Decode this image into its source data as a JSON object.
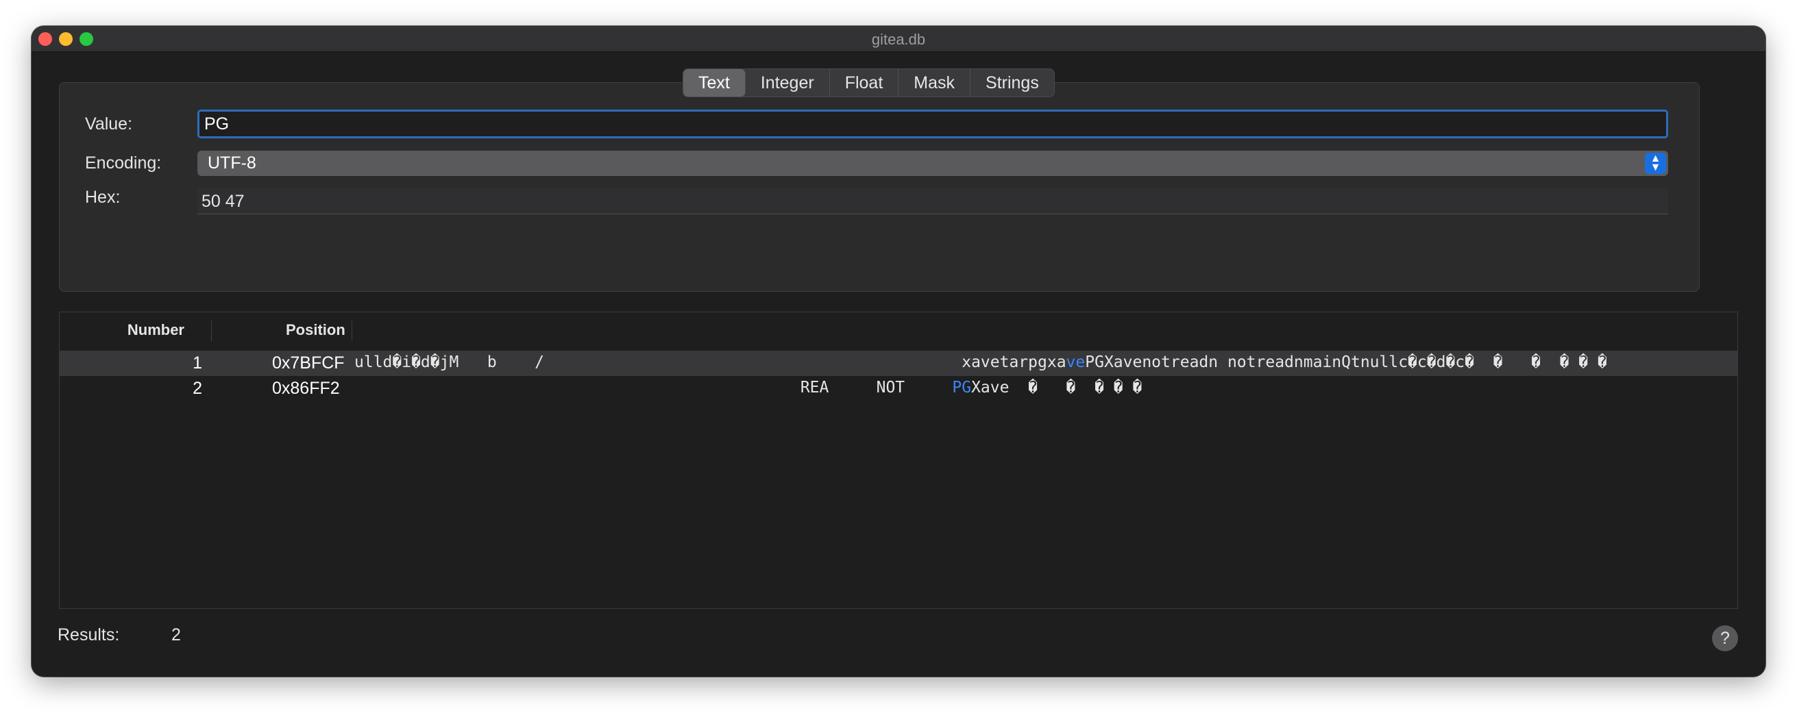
{
  "window": {
    "title": "gitea.db"
  },
  "tabs": [
    {
      "label": "Text",
      "active": true
    },
    {
      "label": "Integer",
      "active": false
    },
    {
      "label": "Float",
      "active": false
    },
    {
      "label": "Mask",
      "active": false
    },
    {
      "label": "Strings",
      "active": false
    }
  ],
  "form": {
    "value_label": "Value:",
    "value": "PG",
    "encoding_label": "Encoding:",
    "encoding": "UTF-8",
    "hex_label": "Hex:",
    "hex": "50 47"
  },
  "table": {
    "columns": [
      "Number",
      "Position"
    ],
    "rows": [
      {
        "number": "1",
        "position": "0x7BFCF",
        "snippet_before": "ulld�i�d�jM   b    /                                            xavetarpgxa",
        "snippet_match": "ve",
        "snippet_after": "PGXavenotreadn notreadnmainQtnullc�c�d�c�  �   �  � � �"
      },
      {
        "number": "2",
        "position": "0x86FF2",
        "snippet_before": "                                               REA     NOT     ",
        "snippet_match": "PG",
        "snippet_after": "Xave  �   �  � � �"
      }
    ]
  },
  "footer": {
    "results_label": "Results:",
    "results_count": "2",
    "help_label": "?"
  },
  "colors": {
    "accent": "#2f6db8",
    "highlight": "#3b86f7",
    "background": "#1e1e1f"
  }
}
